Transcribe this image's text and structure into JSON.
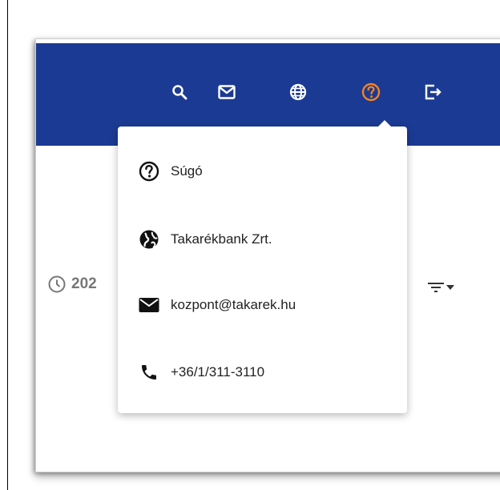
{
  "colors": {
    "topbar": "#1b3a93",
    "active_icon": "#f58220",
    "icon_white": "#ffffff",
    "text": "#222222",
    "muted": "#777777"
  },
  "topbar": {
    "icons": [
      "search-icon",
      "mail-icon",
      "globe-icon",
      "help-icon",
      "logout-icon"
    ],
    "active": "help-icon"
  },
  "content": {
    "date_prefix": "202"
  },
  "help_menu": {
    "items": [
      {
        "icon": "help-circle-icon",
        "label": "Súgó"
      },
      {
        "icon": "globe-icon",
        "label": "Takarékbank Zrt."
      },
      {
        "icon": "mail-icon",
        "label": "kozpont@takarek.hu"
      },
      {
        "icon": "phone-icon",
        "label": "+36/1/311-3110"
      }
    ]
  }
}
